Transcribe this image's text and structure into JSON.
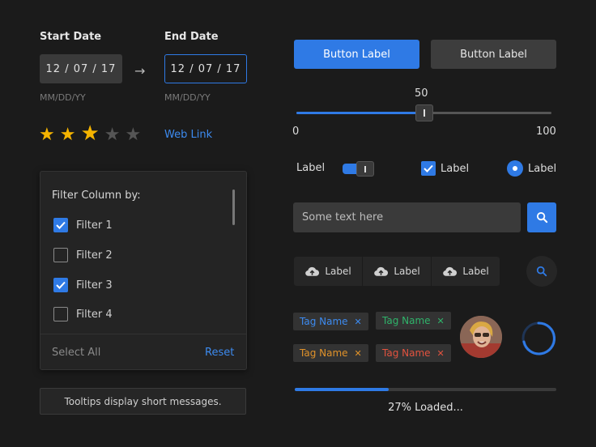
{
  "dates": {
    "start_label": "Start Date",
    "end_label": "End Date",
    "start_value": "12 / 07 / 17",
    "end_value": "12 / 07 / 17",
    "format_hint": "MM/DD/YY",
    "arrow": "→"
  },
  "rating": {
    "value": 3,
    "max": 5
  },
  "web_link": "Web Link",
  "filter": {
    "title": "Filter Column by:",
    "items": [
      {
        "label": "Filter 1",
        "checked": true
      },
      {
        "label": "Filter 2",
        "checked": false
      },
      {
        "label": "Filter 3",
        "checked": true
      },
      {
        "label": "Filter 4",
        "checked": false
      }
    ],
    "select_all": "Select All",
    "reset": "Reset"
  },
  "tooltip": "Tooltips display short messages.",
  "buttons": {
    "primary": "Button Label",
    "secondary": "Button Label"
  },
  "slider": {
    "min": "0",
    "max": "100",
    "value": "50",
    "fraction": 0.5
  },
  "controls": {
    "toggle_label": "Label",
    "checkbox_label": "Label",
    "radio_label": "Label"
  },
  "search": {
    "placeholder": "Some text here"
  },
  "segmented": [
    "Label",
    "Label",
    "Label"
  ],
  "tags": [
    {
      "label": "Tag Name",
      "color": "#3d8bf0"
    },
    {
      "label": "Tag Name",
      "color": "#2fb36a"
    },
    {
      "label": "Tag Name",
      "color": "#e0922a"
    },
    {
      "label": "Tag Name",
      "color": "#e2533f"
    }
  ],
  "progress": {
    "text": "27% Loaded...",
    "fraction": 0.36
  },
  "colors": {
    "accent": "#2f7ae5",
    "star": "#f5b400",
    "star_off": "#555555"
  }
}
